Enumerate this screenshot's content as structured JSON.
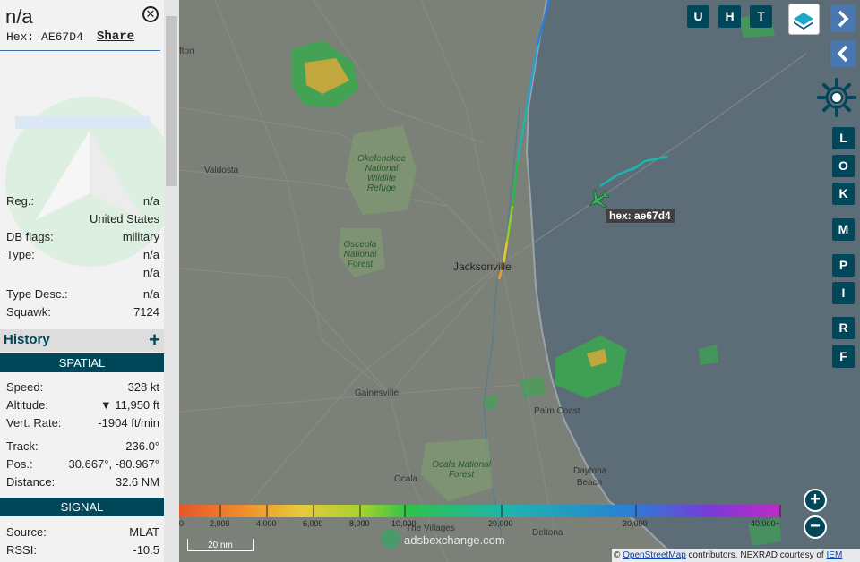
{
  "sidebar": {
    "title": "n/a",
    "hex_label": "Hex:",
    "hex_value": "AE67D4",
    "share": "Share",
    "close_icon": "close-icon",
    "info": [
      {
        "label": "Reg.:",
        "value": "n/a"
      },
      {
        "label": "",
        "value": "United States"
      },
      {
        "label": "DB flags:",
        "value": "military"
      },
      {
        "label": "Type:",
        "value": "n/a"
      },
      {
        "label": "",
        "value": "n/a"
      },
      {
        "label": "Type Desc.:",
        "value": "n/a"
      },
      {
        "label": "Squawk:",
        "value": "7124"
      }
    ],
    "history": "History",
    "history_icon": "plus-icon",
    "spatial_header": "SPATIAL",
    "spatial": [
      {
        "label": "Speed:",
        "value": "328 kt"
      },
      {
        "label": "Altitude:",
        "value": "▼ 11,950 ft"
      },
      {
        "label": "Vert. Rate:",
        "value": "-1904 ft/min"
      },
      {
        "label": "Track:",
        "value": "236.0°"
      },
      {
        "label": "Pos.:",
        "value": "30.667°, -80.967°"
      },
      {
        "label": "Distance:",
        "value": "32.6 NM"
      }
    ],
    "signal_header": "SIGNAL",
    "signal": [
      {
        "label": "Source:",
        "value": "MLAT"
      },
      {
        "label": "RSSI:",
        "value": "-10.5"
      }
    ]
  },
  "map": {
    "top_buttons": [
      "U",
      "H",
      "T"
    ],
    "side_buttons": [
      "L",
      "O",
      "K",
      "M",
      "P",
      "I",
      "R",
      "F"
    ],
    "plane_label": "hex: ae67d4",
    "places": [
      {
        "name": "Valdosta"
      },
      {
        "name": "Okefenokee National Wildlife Refuge"
      },
      {
        "name": "Osceola National Forest"
      },
      {
        "name": "Jacksonville"
      },
      {
        "name": "Gainesville"
      },
      {
        "name": "Palm Coast"
      },
      {
        "name": "Ocala National Forest"
      },
      {
        "name": "Ocala"
      },
      {
        "name": "Daytona Beach"
      },
      {
        "name": "The Villages"
      },
      {
        "name": "Deltona"
      },
      {
        "name": "fton"
      }
    ],
    "legend_ticks": [
      "0",
      "2,000",
      "4,000",
      "6,000",
      "8,000",
      "10,000",
      "20,000",
      "30,000",
      "40,000+"
    ],
    "scale": "20 nm",
    "logo": "adsbexchange.com",
    "attribution_prefix": "©",
    "attribution_osm": "OpenStreetMap",
    "attribution_mid": "contributors. NEXRAD courtesy of",
    "attribution_iem": "IEM",
    "zoom_in": "+",
    "zoom_out": "−"
  },
  "colors": {
    "accent": "#00475a",
    "nav_button": "#4a77b0",
    "plane": "#3bb35b",
    "map_land": "#7b8078",
    "map_water": "#5d6d78"
  }
}
